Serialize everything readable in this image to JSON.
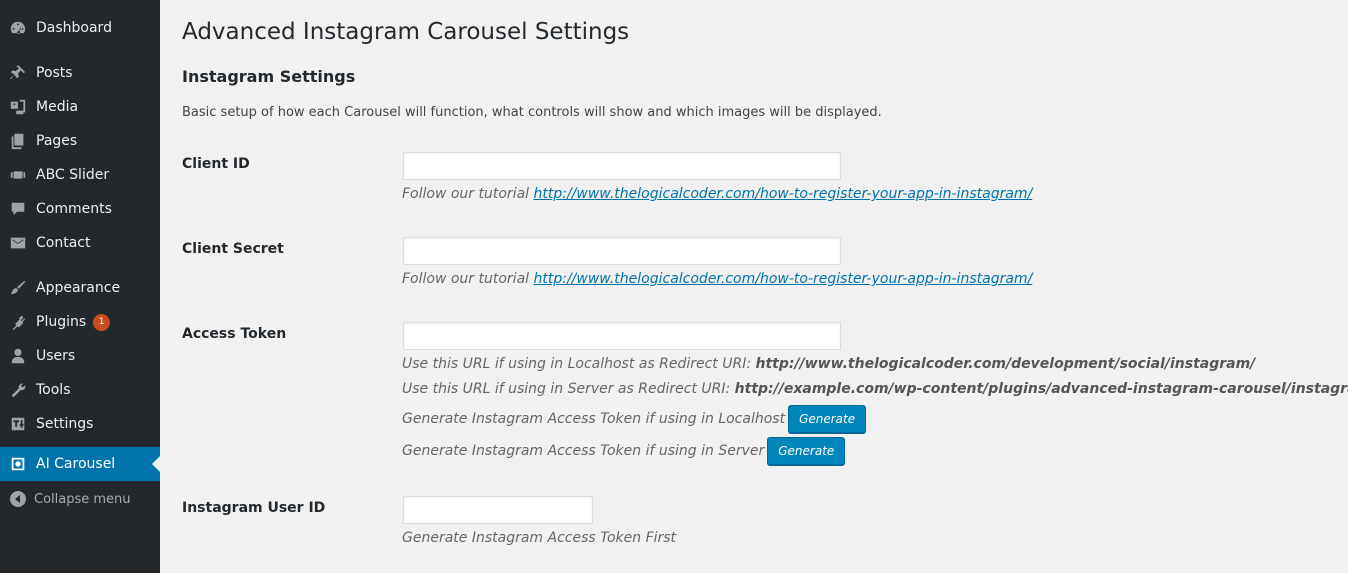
{
  "sidebar": {
    "items": [
      {
        "label": "Dashboard",
        "icon": "dashboard-icon"
      },
      {
        "label": "Posts",
        "icon": "pin-icon"
      },
      {
        "label": "Media",
        "icon": "media-icon"
      },
      {
        "label": "Pages",
        "icon": "pages-icon"
      },
      {
        "label": "ABC Slider",
        "icon": "slider-icon"
      },
      {
        "label": "Comments",
        "icon": "comment-icon"
      },
      {
        "label": "Contact",
        "icon": "mail-icon"
      },
      {
        "label": "Appearance",
        "icon": "brush-icon"
      },
      {
        "label": "Plugins",
        "icon": "plugin-icon",
        "badge": "1"
      },
      {
        "label": "Users",
        "icon": "user-icon"
      },
      {
        "label": "Tools",
        "icon": "wrench-icon"
      },
      {
        "label": "Settings",
        "icon": "settings-icon"
      },
      {
        "label": "AI Carousel",
        "icon": "camera-icon",
        "active": true
      }
    ],
    "collapse_label": "Collapse menu"
  },
  "colors": {
    "sidebar_bg": "#23282d",
    "accent": "#0073aa",
    "button": "#0085ba",
    "badge": "#ca4a1f"
  },
  "page": {
    "title": "Advanced Instagram Carousel Settings",
    "section_title": "Instagram Settings",
    "section_desc": "Basic setup of how each Carousel will function, what controls will show and which images will be displayed."
  },
  "fields": {
    "client_id": {
      "label": "Client ID",
      "value": "",
      "help_prefix": "Follow our tutorial ",
      "help_link": "http://www.thelogicalcoder.com/how-to-register-your-app-in-instagram/"
    },
    "client_secret": {
      "label": "Client Secret",
      "value": "",
      "help_prefix": "Follow our tutorial ",
      "help_link": "http://www.thelogicalcoder.com/how-to-register-your-app-in-instagram/"
    },
    "access_token": {
      "label": "Access Token",
      "value": "",
      "localhost_prefix": "Use this URL if using in Localhost as Redirect URI: ",
      "localhost_url": "http://www.thelogicalcoder.com/development/social/instagram/",
      "server_prefix": "Use this URL if using in Server as Redirect URI: ",
      "server_url": "http://example.com/wp-content/plugins/advanced-instagram-carousel/instagram/",
      "gen_localhost_text": "Generate Instagram Access Token if using in Localhost",
      "gen_server_text": "Generate Instagram Access Token if using in Server",
      "generate_label": "Generate"
    },
    "user_id": {
      "label": "Instagram User ID",
      "value": "",
      "help": "Generate Instagram Access Token First"
    }
  }
}
